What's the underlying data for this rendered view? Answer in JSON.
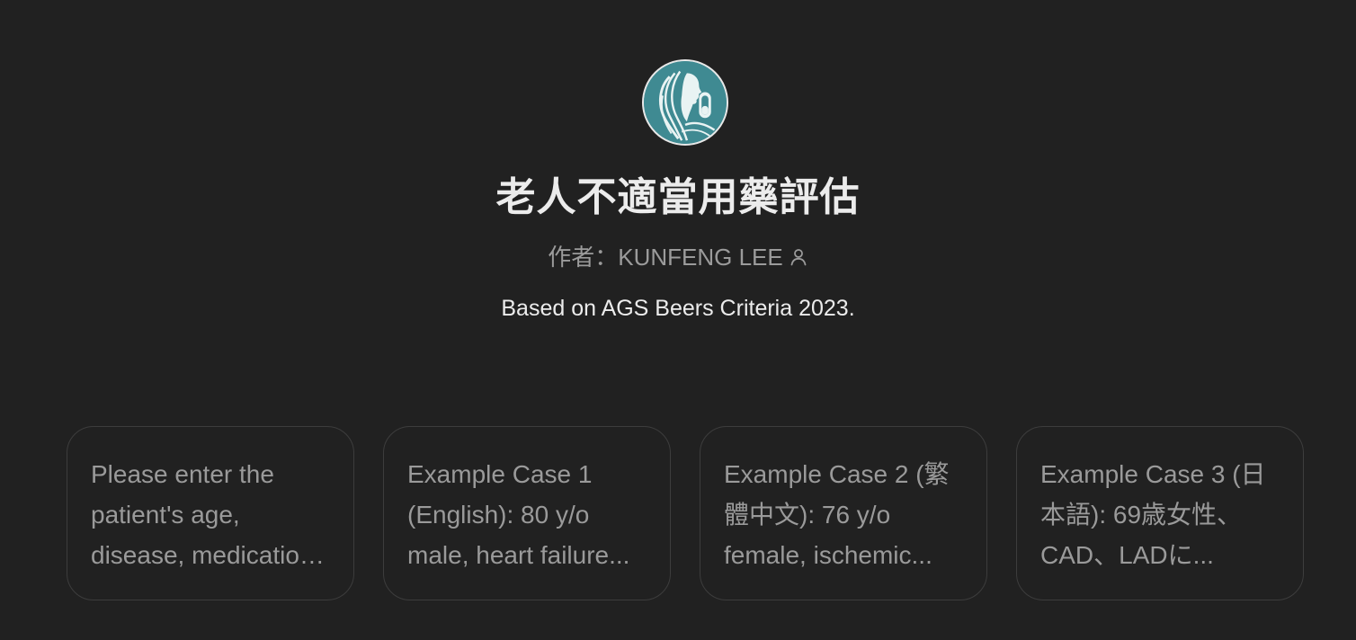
{
  "gpt": {
    "avatar_icon": "stylized-woman-profile-with-pill-capsule-logo",
    "title": "老人不適當用藥評估",
    "author_label": "作者：KUNFENG LEE",
    "author_icon": "person-icon",
    "description": "Based on AGS Beers Criteria 2023."
  },
  "starters": [
    {
      "text": "Please enter the patient's age, disease, medications and other information."
    },
    {
      "text": "Example Case 1 (English): 80 y/o male, heart failure..."
    },
    {
      "text": "Example Case 2 (繁體中文): 76 y/o female, ischemic..."
    },
    {
      "text": "Example Case 3 (日本語): 69歳女性、CAD、LADに..."
    }
  ],
  "colors": {
    "background": "#212121",
    "avatar_teal": "#3f8a92",
    "text_primary": "#ececec",
    "text_muted": "#9b9b9b",
    "card_border": "#3d3d3d"
  }
}
